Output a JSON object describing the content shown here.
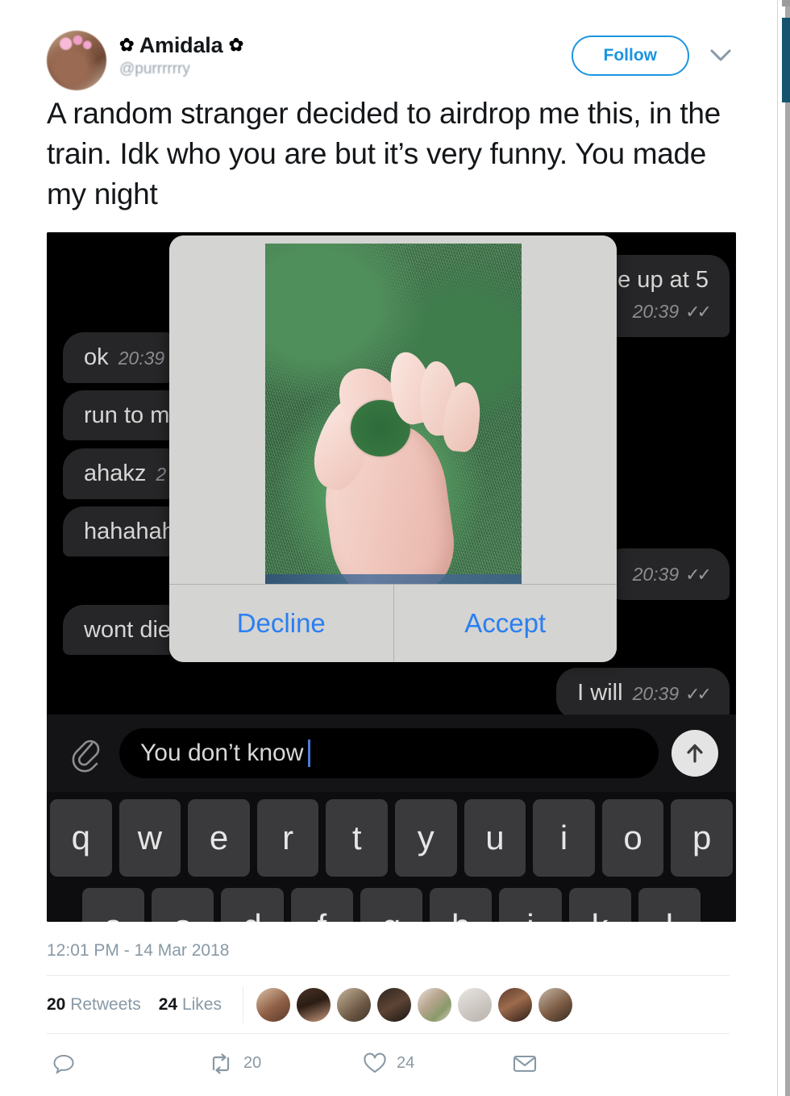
{
  "tweet": {
    "author": {
      "display_name": "Amidala",
      "name_decoration_left": "✿",
      "name_decoration_right": "✿",
      "handle": "@purrrrrry",
      "avatar_name": "profile-photo"
    },
    "follow_label": "Follow",
    "caret_icon": "chevron-down-icon",
    "text": "A random stranger decided to airdrop me this, in the train. Idk who you are but it’s very funny. You made my night",
    "timestamp": "12:01 PM - 14 Mar 2018",
    "stats": {
      "retweets_count": "20",
      "retweets_label": "Retweets",
      "likes_count": "24",
      "likes_label": "Likes"
    },
    "liker_avatars": [
      "liker-1",
      "liker-2",
      "liker-3",
      "liker-4",
      "liker-5",
      "liker-6",
      "liker-7",
      "liker-8"
    ],
    "actions": {
      "reply": {
        "icon": "reply-icon",
        "count": ""
      },
      "retweet": {
        "icon": "retweet-icon",
        "count": "20"
      },
      "like": {
        "icon": "heart-icon",
        "count": "24"
      },
      "message": {
        "icon": "envelope-icon",
        "count": ""
      }
    }
  },
  "media": {
    "kind": "imessage-screenshot",
    "messages": [
      {
        "side": "right",
        "line1": "e up at 5",
        "time": "20:39",
        "ticks": "✓✓"
      },
      {
        "side": "left",
        "text": "ok",
        "time": "20:39",
        "ticks": ""
      },
      {
        "side": "left",
        "text": "run to m",
        "time": "",
        "ticks": ""
      },
      {
        "side": "left",
        "text": "ahakz",
        "time": "2",
        "ticks": ""
      },
      {
        "side": "left",
        "text": "hahahah",
        "time": "",
        "ticks": ""
      },
      {
        "side": "right",
        "text": "",
        "time": "20:39",
        "ticks": "✓✓"
      },
      {
        "side": "left",
        "text": "wont die",
        "time": "",
        "ticks": ""
      },
      {
        "side": "right",
        "text": "I will",
        "time": "20:39",
        "ticks": "✓✓"
      }
    ],
    "airdrop": {
      "photo_description": "hand-ok-gesture-on-grass",
      "decline_label": "Decline",
      "accept_label": "Accept"
    },
    "composer": {
      "attach_icon": "paperclip-icon",
      "input_value": "You don’t know ",
      "send_icon": "send-arrow-up-icon"
    },
    "keyboard": {
      "row1": [
        "q",
        "w",
        "e",
        "r",
        "t",
        "y",
        "u",
        "i",
        "o",
        "p"
      ],
      "row2": [
        "a",
        "s",
        "d",
        "f",
        "g",
        "h",
        "j",
        "k",
        "l"
      ]
    }
  },
  "colors": {
    "twitter_blue": "#1b95e0",
    "ios_blue": "#2b7ef2",
    "muted_text": "#8899a6",
    "scrollbar_thumb": "#15536f"
  }
}
